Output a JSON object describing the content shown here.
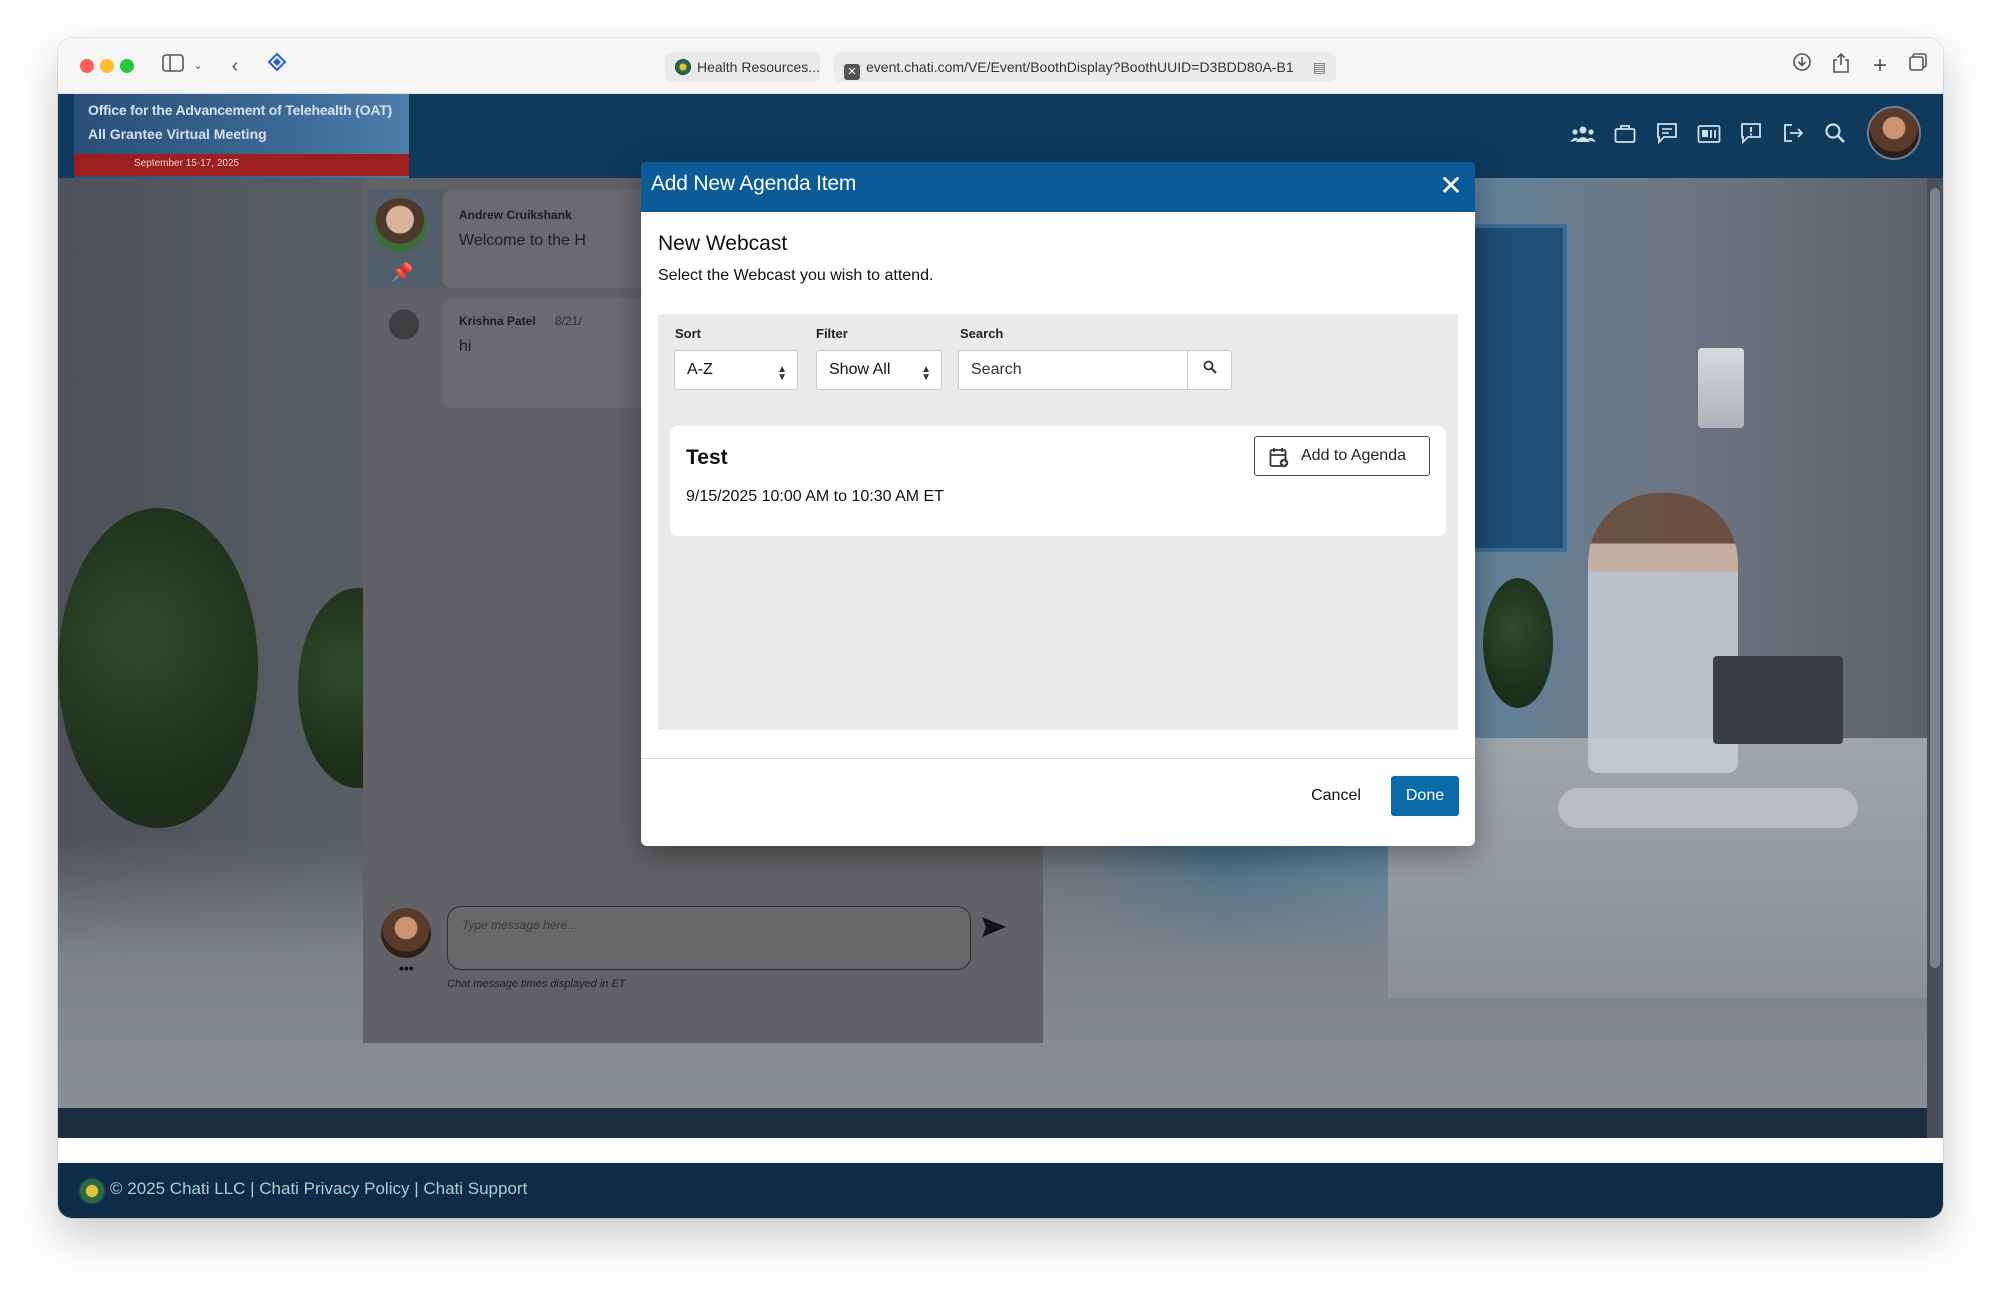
{
  "browser": {
    "tab_label": "Health Resources...",
    "url": "event.chati.com/VE/Event/BoothDisplay?BoothUUID=D3BDD80A-B1"
  },
  "header": {
    "logo_line1": "Office for the Advancement of Telehealth (OAT)",
    "logo_line2": "All Grantee Virtual Meeting",
    "logo_date": "September 15-17, 2025"
  },
  "chat": {
    "messages": [
      {
        "name": "Andrew Cruikshank",
        "time": "",
        "text": "Welcome to the H"
      },
      {
        "name": "Krishna Patel",
        "time": "8/21/",
        "text": "hi"
      }
    ],
    "input_placeholder": "Type message here...",
    "more_label": "•••",
    "note": "Chat message times displayed in ET"
  },
  "modal": {
    "title": "Add New Agenda Item",
    "close_label": "✕",
    "section_title": "New Webcast",
    "section_subtitle": "Select the Webcast you wish to attend.",
    "sort": {
      "label": "Sort",
      "value": "A-Z"
    },
    "filter": {
      "label": "Filter",
      "value": "Show All"
    },
    "search": {
      "label": "Search",
      "placeholder": "Search"
    },
    "items": [
      {
        "title": "Test",
        "time": "9/15/2025 10:00 AM to 10:30 AM ET",
        "button": "Add to Agenda"
      }
    ],
    "cancel_label": "Cancel",
    "done_label": "Done"
  },
  "footer": {
    "copyright": "© 2025 Chati LLC",
    "separator": " | ",
    "privacy": "Chati Privacy Policy",
    "support": "Chati Support"
  },
  "colors": {
    "modal_header": "#0a5b97",
    "done_button": "#0b6ba8",
    "app_header": "#0f3a5c",
    "footer": "#0e2c47"
  }
}
